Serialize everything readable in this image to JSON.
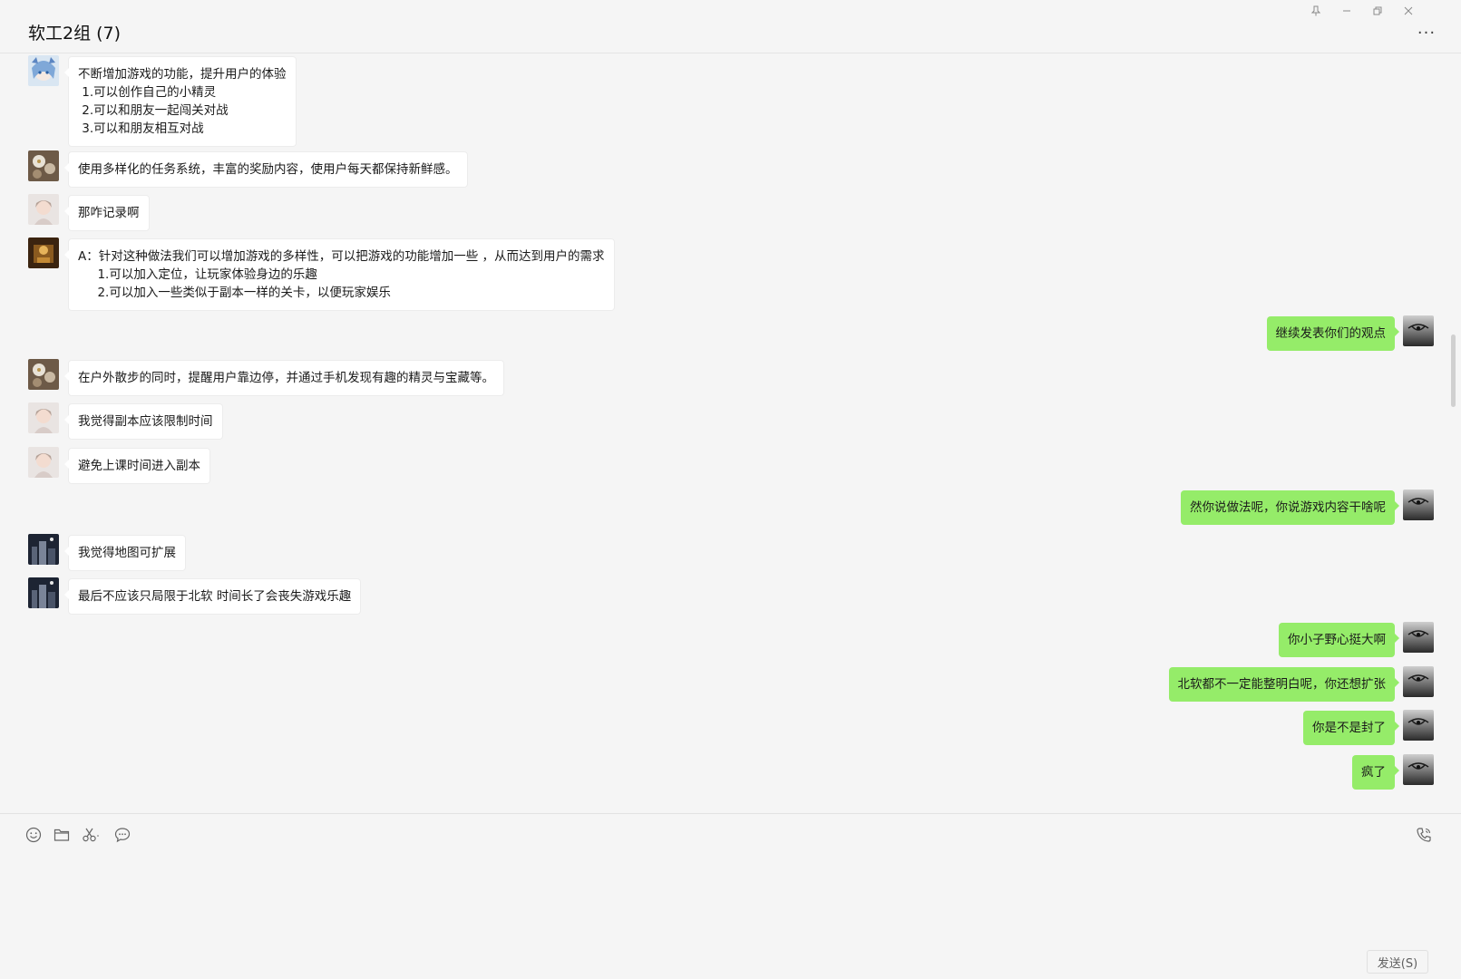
{
  "window": {
    "title": "软工2组 (7)",
    "controls": {
      "pin": "pin-icon",
      "minimize": "minimize-icon",
      "restore": "restore-icon",
      "close": "close-icon"
    },
    "more": "···"
  },
  "colors": {
    "incoming_bubble": "#ffffff",
    "outgoing_bubble": "#95ec69",
    "background": "#f5f5f5"
  },
  "messages": [
    {
      "side": "in",
      "avatar": "anime-girl-avatar",
      "text": "不断增加游戏的功能，提升用户的体验\n 1.可以创作自己的小精灵\n 2.可以和朋友一起闯关对战\n 3.可以和朋友相互对战"
    },
    {
      "side": "in",
      "avatar": "flower-photo-avatar",
      "text": "使用多样化的任务系统，丰富的奖励内容，使用户每天都保持新鲜感。"
    },
    {
      "side": "in",
      "avatar": "girl-portrait-avatar",
      "text": "那咋记录啊"
    },
    {
      "side": "in",
      "avatar": "golden-scene-avatar",
      "text": "A：针对这种做法我们可以增加游戏的多样性，可以把游戏的功能增加一些 ，从而达到用户的需求\n     1.可以加入定位，让玩家体验身边的乐趣\n     2.可以加入一些类似于副本一样的关卡，以便玩家娱乐"
    },
    {
      "side": "out",
      "avatar": "self-avatar",
      "text": "继续发表你们的观点"
    },
    {
      "side": "in",
      "avatar": "flower-photo-avatar",
      "text": "在户外散步的同时，提醒用户靠边停，并通过手机发现有趣的精灵与宝藏等。"
    },
    {
      "side": "in",
      "avatar": "girl-portrait-avatar",
      "text": "我觉得副本应该限制时间"
    },
    {
      "side": "in",
      "avatar": "girl-portrait-avatar",
      "text": "避免上课时间进入副本"
    },
    {
      "side": "out",
      "avatar": "self-avatar",
      "text": "然你说做法呢，你说游戏内容干啥呢"
    },
    {
      "side": "in",
      "avatar": "night-city-avatar",
      "text": "我觉得地图可扩展"
    },
    {
      "side": "in",
      "avatar": "night-city-avatar",
      "text": "最后不应该只局限于北软 时间长了会丧失游戏乐趣"
    },
    {
      "side": "out",
      "avatar": "self-avatar",
      "text": "你小子野心挺大啊"
    },
    {
      "side": "out",
      "avatar": "self-avatar",
      "text": "北软都不一定能整明白呢，你还想扩张"
    },
    {
      "side": "out",
      "avatar": "self-avatar",
      "text": "你是不是封了"
    },
    {
      "side": "out",
      "avatar": "self-avatar",
      "text": "疯了"
    }
  ],
  "toolbar": {
    "emoji": "emoji-icon",
    "file": "folder-icon",
    "screenshot": "scissors-icon",
    "chat_history": "chat-bubble-icon",
    "call": "phone-icon"
  },
  "composer": {
    "send_label": "发送(S)"
  }
}
